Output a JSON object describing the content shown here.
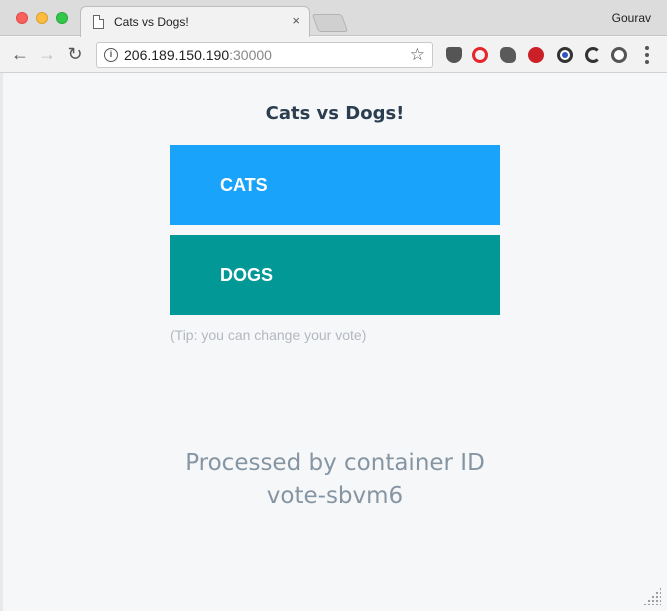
{
  "window": {
    "profile_name": "Gourav",
    "tab": {
      "title": "Cats vs Dogs!",
      "close_glyph": "×"
    }
  },
  "toolbar": {
    "back_glyph": "←",
    "forward_glyph": "→",
    "reload_glyph": "↻",
    "url_host": "206.189.150.190",
    "url_port": ":30000",
    "info_glyph": "i",
    "star_glyph": "☆"
  },
  "page": {
    "title": "Cats vs Dogs!",
    "options": [
      {
        "label": "CATS",
        "color": "#1aa3fb"
      },
      {
        "label": "DOGS",
        "color": "#019896"
      }
    ],
    "tip": "(Tip: you can change your vote)",
    "processed_line1": "Processed by container ID",
    "processed_line2": "vote-sbvm6"
  }
}
